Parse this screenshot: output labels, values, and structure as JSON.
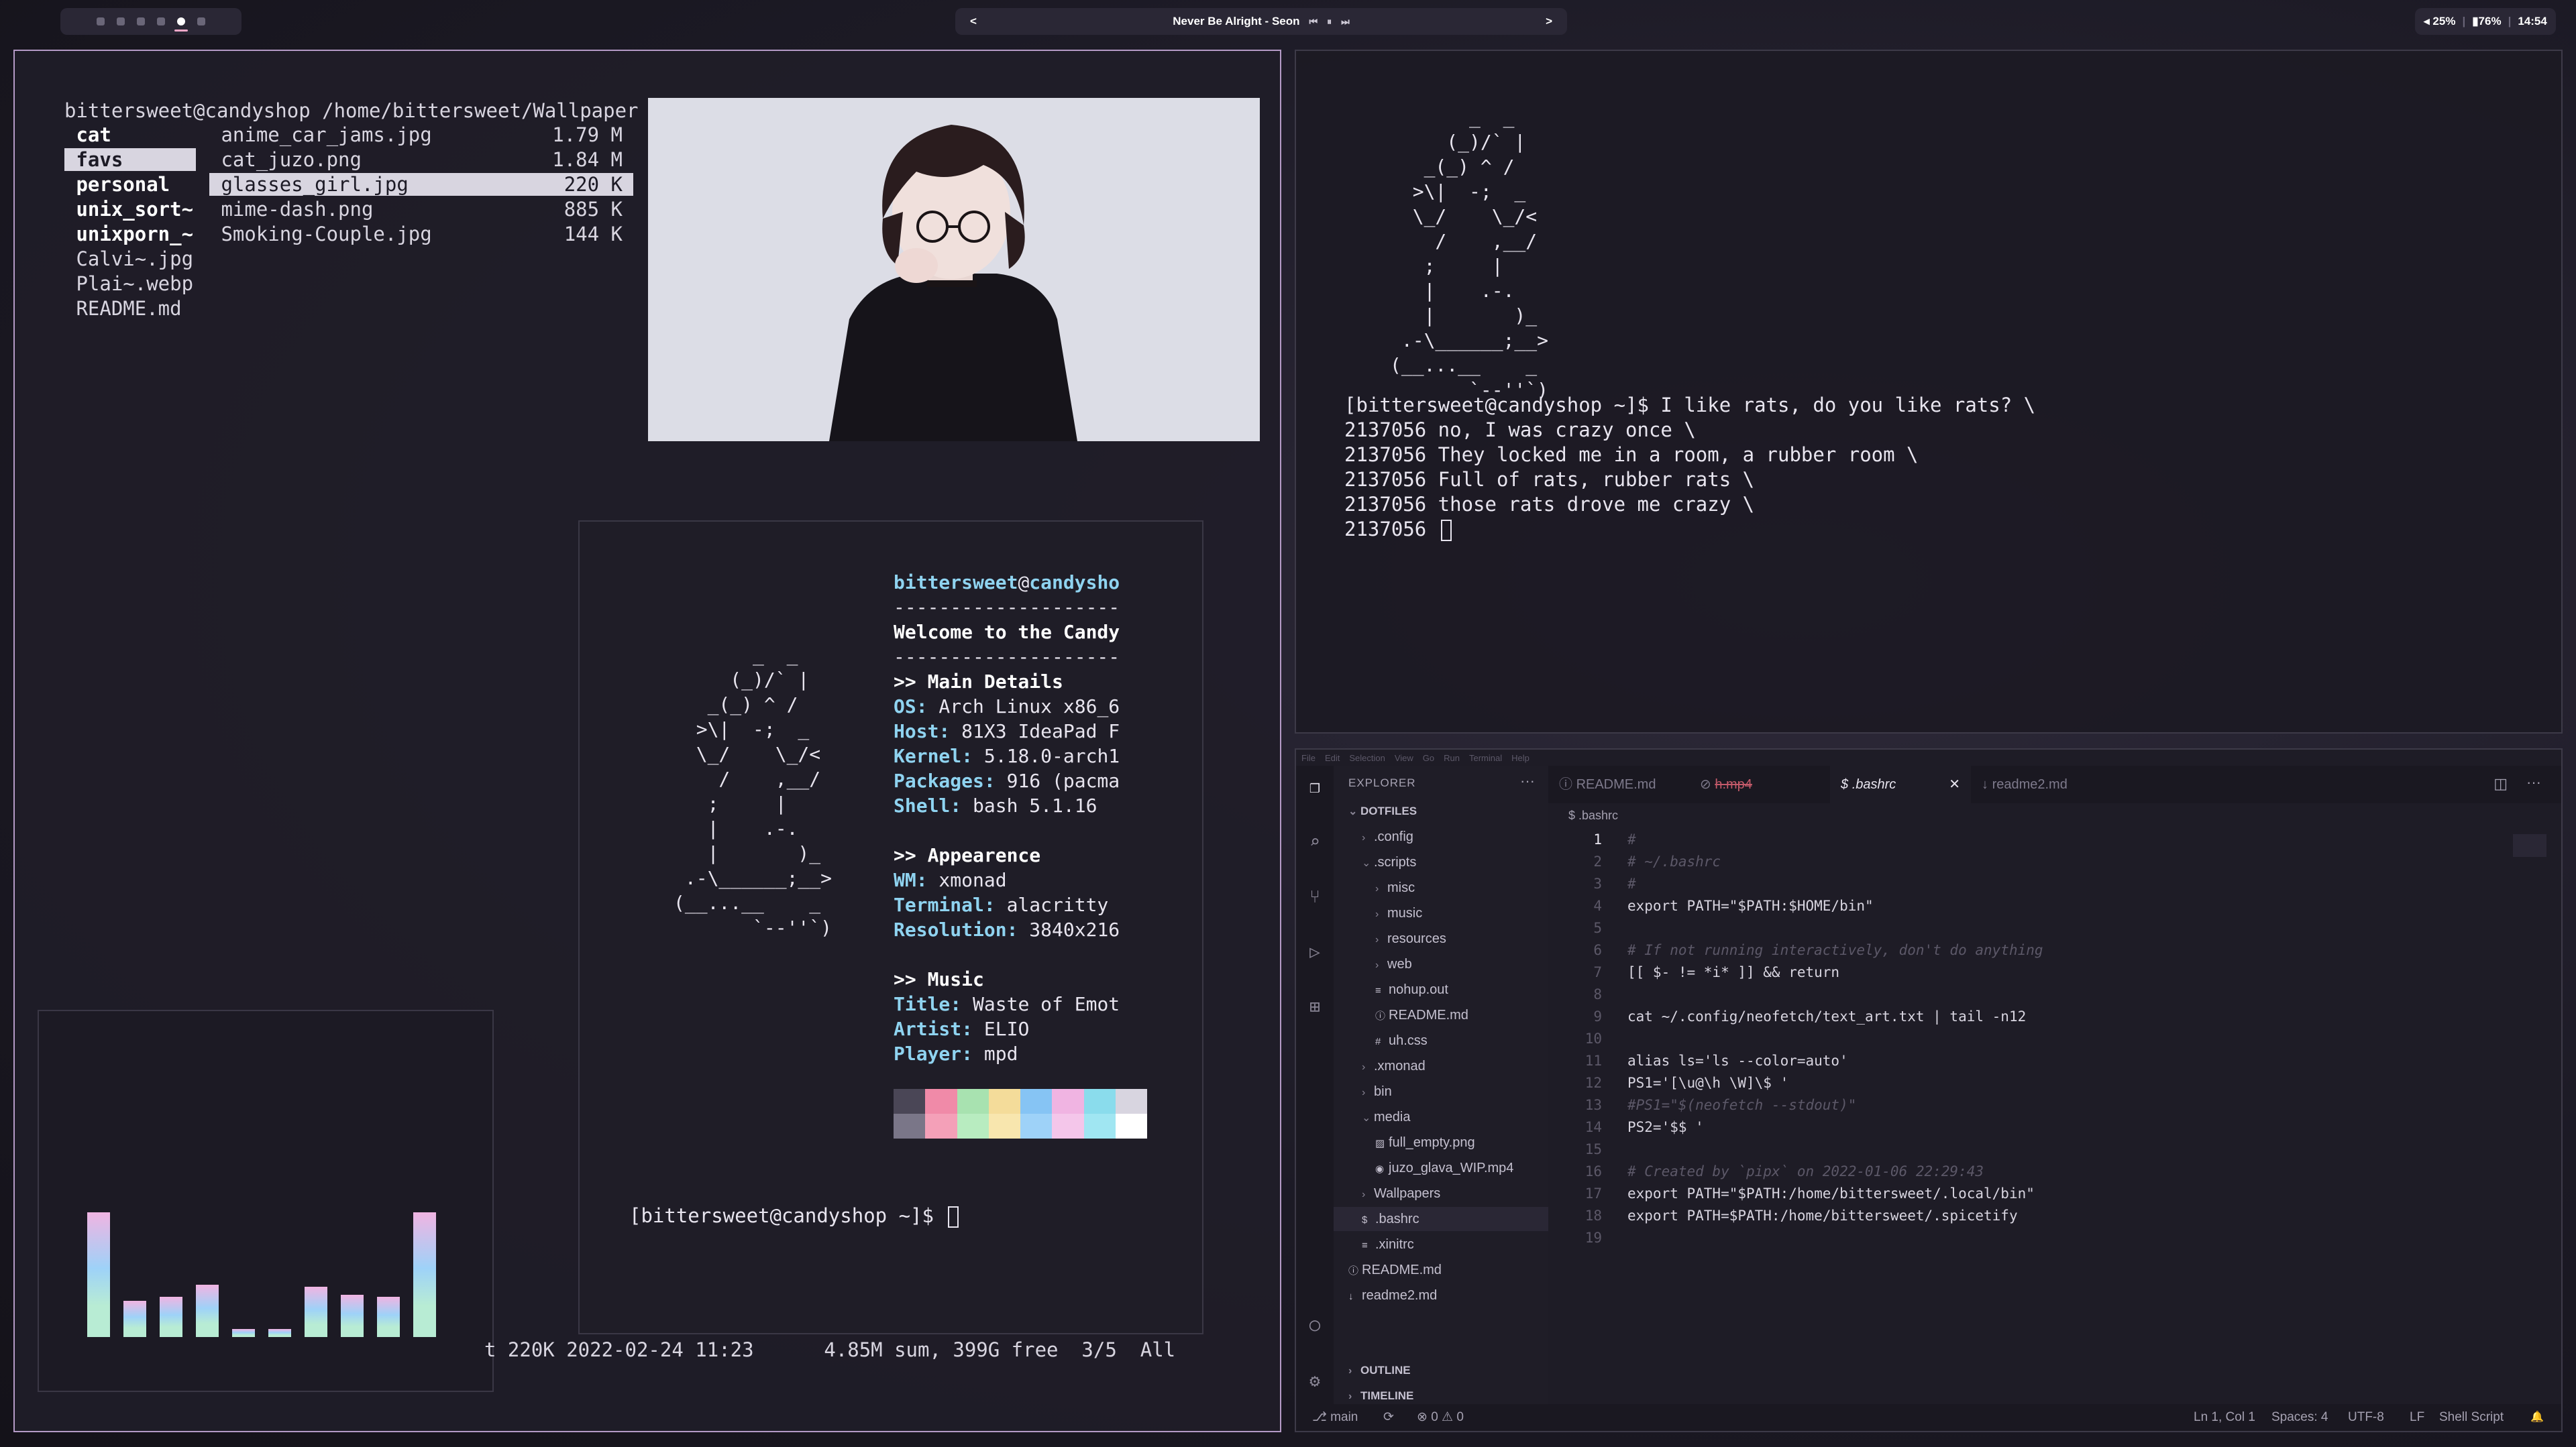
{
  "topbar": {
    "workspaces": [
      "1",
      "2",
      "3",
      "4",
      "5",
      "6"
    ],
    "active_workspace": 5,
    "now_playing": "Never Be Alright - Seon",
    "prev_glyph": "<",
    "next_glyph": ">",
    "ctrl_prev": "⏮",
    "ctrl_pause": "⏸",
    "ctrl_next": "⏭",
    "volume": "◂ 25%",
    "battery": "▮76%",
    "clock": "14:54"
  },
  "ranger": {
    "path_line": "bittersweet@candyshop /home/bittersweet/Wallpaper",
    "parent": [
      {
        "name": "cat",
        "dir": true
      },
      {
        "name": "favs",
        "dir": true,
        "selected": true
      },
      {
        "name": "personal",
        "dir": true
      },
      {
        "name": "unix_sort~",
        "dir": true
      },
      {
        "name": "unixporn_~",
        "dir": true
      },
      {
        "name": "Calvi~.jpg",
        "dir": false
      },
      {
        "name": "Plai~.webp",
        "dir": false
      },
      {
        "name": "README.md",
        "dir": false
      }
    ],
    "files": [
      {
        "name": "anime_car_jams.jpg",
        "size": "1.79 M"
      },
      {
        "name": "cat_juzo.png",
        "size": "1.84 M"
      },
      {
        "name": "glasses_girl.jpg",
        "size": "220 K",
        "selected": true
      },
      {
        "name": "mime-dash.png",
        "size": "885 K"
      },
      {
        "name": "Smoking-Couple.jpg",
        "size": "144 K"
      }
    ],
    "status": "t 220K 2022-02-24 11:23      4.85M sum, 399G free  3/5  All"
  },
  "neofetch": {
    "ascii": "       _  _\n     (_)/` |\n   _(_) ^ /\n  >\\|  -;  _\n  \\_/    \\_/<\n    /    ,__/\n   ;     |\n   |    .-.\n   |       )_\n .-\\______;__>\n(__...__    _\n       `--''`)",
    "user": "bittersweet",
    "at": "@",
    "host": "candysho",
    "divider": "--------------------",
    "welcome": "Welcome to the Candy",
    "main_header": ">> Main Details",
    "os_key": "OS:",
    "os": " Arch Linux x86_6",
    "host_key": "Host:",
    "host_val": " 81X3 IdeaPad F",
    "kernel_key": "Kernel:",
    "kernel": " 5.18.0-arch1",
    "packages_key": "Packages:",
    "packages": " 916 (pacma",
    "shell_key": "Shell:",
    "shell": " bash 5.1.16",
    "appear_header": ">> Appearence",
    "wm_key": "WM:",
    "wm": " xmonad",
    "term_key": "Terminal:",
    "term": " alacritty",
    "res_key": "Resolution:",
    "res": " 3840x216",
    "music_header": ">> Music",
    "title_key": "Title:",
    "title": " Waste of Emot",
    "artist_key": "Artist:",
    "artist": " ELIO",
    "player_key": "Player:",
    "player": " mpd",
    "palette_top": [
      "#4a4656",
      "#f08aa8",
      "#a8e2b0",
      "#f4dc9a",
      "#86c4f4",
      "#f0b4e2",
      "#8adcec",
      "#d8d5e0"
    ],
    "palette_bottom": [
      "#7a7688",
      "#f4a0b8",
      "#b8ecc0",
      "#f8e6ae",
      "#9ed2f8",
      "#f4c6ea",
      "#a0e6f2",
      "#ffffff"
    ],
    "prompt": "[bittersweet@candyshop ~]$"
  },
  "visualizer": {
    "levels": [
      0.62,
      0.18,
      0.2,
      0.26,
      0.04,
      0.04,
      0.25,
      0.21,
      0.2,
      0.62
    ]
  },
  "term2": {
    "ascii": "       _  _\n     (_)/` |\n   _(_) ^ /\n  >\\|  -;  _\n  \\_/    \\_/<\n    /    ,__/\n   ;     |\n   |    .-.\n   |       )_\n .-\\______;__>\n(__...__    _\n       `--''`)",
    "lines": [
      "[bittersweet@candyshop ~]$ I like rats, do you like rats? \\",
      "2137056 no, I was crazy once \\",
      "2137056 They locked me in a room, a rubber room \\",
      "2137056 Full of rats, rubber rats \\",
      "2137056 those rats drove me crazy \\",
      "2137056 "
    ]
  },
  "vscode": {
    "menu": [
      "File",
      "Edit",
      "Selection",
      "View",
      "Go",
      "Run",
      "Terminal",
      "Help"
    ],
    "explorer_label": "EXPLORER",
    "more": "···",
    "root": "DOTFILES",
    "tree": [
      {
        "name": ".config",
        "depth": 1,
        "chev": "›"
      },
      {
        "name": ".scripts",
        "depth": 1,
        "chev": "⌄"
      },
      {
        "name": "misc",
        "depth": 2,
        "chev": "›"
      },
      {
        "name": "music",
        "depth": 2,
        "chev": "›"
      },
      {
        "name": "resources",
        "depth": 2,
        "chev": "›"
      },
      {
        "name": "web",
        "depth": 2,
        "chev": "›"
      },
      {
        "name": "nohup.out",
        "depth": 2,
        "chev": "",
        "icon": "≡"
      },
      {
        "name": "README.md",
        "depth": 2,
        "chev": "",
        "icon": "ⓘ"
      },
      {
        "name": "uh.css",
        "depth": 2,
        "chev": "",
        "icon": "#"
      },
      {
        "name": ".xmonad",
        "depth": 1,
        "chev": "›"
      },
      {
        "name": "bin",
        "depth": 1,
        "chev": "›"
      },
      {
        "name": "media",
        "depth": 1,
        "chev": "⌄"
      },
      {
        "name": "full_empty.png",
        "depth": 2,
        "chev": "",
        "icon": "▨"
      },
      {
        "name": "juzo_glava_WIP.mp4",
        "depth": 2,
        "chev": "",
        "icon": "◉"
      },
      {
        "name": "Wallpapers",
        "depth": 1,
        "chev": "›"
      },
      {
        "name": ".bashrc",
        "depth": 1,
        "chev": "",
        "icon": "$",
        "selected": true
      },
      {
        "name": ".xinitrc",
        "depth": 1,
        "chev": "",
        "icon": "≡"
      },
      {
        "name": "README.md",
        "depth": 0,
        "chev": "",
        "icon": "ⓘ"
      },
      {
        "name": "readme2.md",
        "depth": 0,
        "chev": "",
        "icon": "↓"
      }
    ],
    "outline": "OUTLINE",
    "timeline": "TIMELINE",
    "tabs": [
      {
        "label": "README.md",
        "icon": "ⓘ"
      },
      {
        "label": "h.mp4",
        "icon": "⊘",
        "strike": true
      },
      {
        "label": ".bashrc",
        "icon": "$",
        "active": true
      },
      {
        "label": "readme2.md",
        "icon": "↓"
      }
    ],
    "tab_close": "✕",
    "breadcrumb": "$ .bashrc",
    "code_lines": [
      {
        "n": "1",
        "t": "#",
        "cls": "c-com"
      },
      {
        "n": "2",
        "t": "# ~/.bashrc",
        "cls": "c-com"
      },
      {
        "n": "3",
        "t": "#",
        "cls": "c-com"
      },
      {
        "n": "4",
        "t": "export PATH=\"$PATH:$HOME/bin\"",
        "cls": ""
      },
      {
        "n": "5",
        "t": "",
        "cls": ""
      },
      {
        "n": "6",
        "t": "# If not running interactively, don't do anything",
        "cls": "c-com"
      },
      {
        "n": "7",
        "t": "[[ $- != *i* ]] && return",
        "cls": ""
      },
      {
        "n": "8",
        "t": "",
        "cls": ""
      },
      {
        "n": "9",
        "t": "cat ~/.config/neofetch/text_art.txt | tail -n12",
        "cls": ""
      },
      {
        "n": "10",
        "t": "",
        "cls": ""
      },
      {
        "n": "11",
        "t": "alias ls='ls --color=auto'",
        "cls": ""
      },
      {
        "n": "12",
        "t": "PS1='[\\u@\\h \\W]\\$ '",
        "cls": ""
      },
      {
        "n": "13",
        "t": "#PS1=\"$(neofetch --stdout)\"",
        "cls": "c-com"
      },
      {
        "n": "14",
        "t": "PS2='$$ '",
        "cls": ""
      },
      {
        "n": "15",
        "t": "",
        "cls": ""
      },
      {
        "n": "16",
        "t": "# Created by `pipx` on 2022-01-06 22:29:43",
        "cls": "c-com"
      },
      {
        "n": "17",
        "t": "export PATH=\"$PATH:/home/bittersweet/.local/bin\"",
        "cls": ""
      },
      {
        "n": "18",
        "t": "export PATH=$PATH:/home/bittersweet/.spicetify",
        "cls": ""
      },
      {
        "n": "19",
        "t": "",
        "cls": ""
      }
    ],
    "status": {
      "branch": "⎇ main",
      "sync": "⟳",
      "problems": "⊗ 0 ⚠ 0",
      "position": "Ln 1, Col 1",
      "spaces": "Spaces: 4",
      "encoding": "UTF-8",
      "eol": "LF",
      "language": "Shell Script",
      "bell": "🔔"
    }
  }
}
